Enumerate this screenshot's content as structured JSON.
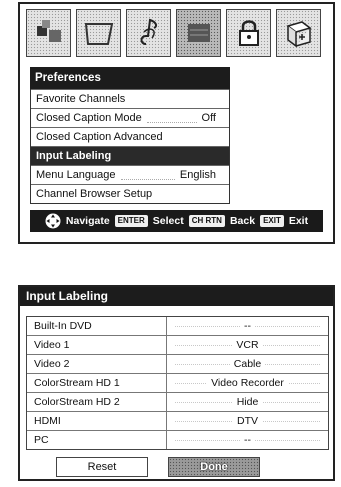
{
  "top_icons": [
    {
      "name": "picture-icon",
      "active": false
    },
    {
      "name": "tv-screen-icon",
      "active": false
    },
    {
      "name": "audio-note-icon",
      "active": false
    },
    {
      "name": "preferences-icon",
      "active": true
    },
    {
      "name": "lock-icon",
      "active": false
    },
    {
      "name": "setup-icon",
      "active": false
    }
  ],
  "menu": {
    "title": "Preferences",
    "items": [
      {
        "label": "Favorite Channels",
        "value": ""
      },
      {
        "label": "Closed Caption Mode",
        "value": "Off"
      },
      {
        "label": "Closed Caption Advanced",
        "value": ""
      },
      {
        "label": "Input Labeling",
        "value": "",
        "selected": true
      },
      {
        "label": "Menu Language",
        "value": "English"
      },
      {
        "label": "Channel Browser Setup",
        "value": ""
      }
    ]
  },
  "navbar": {
    "navigate_label": "Navigate",
    "enter_key": "ENTER",
    "select_label": "Select",
    "chrtn_key": "CH RTN",
    "back_label": "Back",
    "exit_key": "EXIT",
    "exit_label": "Exit"
  },
  "input_labeling": {
    "title": "Input Labeling",
    "rows": [
      {
        "input": "Built-In DVD",
        "label": "--"
      },
      {
        "input": "Video 1",
        "label": "VCR"
      },
      {
        "input": "Video 2",
        "label": "Cable"
      },
      {
        "input": "ColorStream HD 1",
        "label": "Video Recorder"
      },
      {
        "input": "ColorStream HD 2",
        "label": "Hide"
      },
      {
        "input": "HDMI",
        "label": "DTV"
      },
      {
        "input": "PC",
        "label": "--"
      }
    ],
    "reset_label": "Reset",
    "done_label": "Done"
  }
}
